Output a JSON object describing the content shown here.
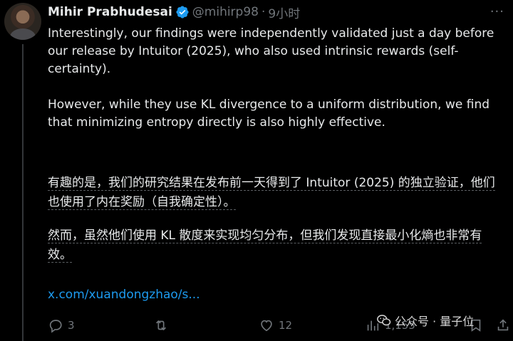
{
  "tweet": {
    "author_name": "Mihir Prabhudesai",
    "handle": "@mihirp98",
    "separator": "·",
    "time": "9小时",
    "verified_color": "#1d9bf0",
    "paragraphs": [
      "Interestingly, our findings were independently validated just a day before our release by Intuitor (2025), who also used intrinsic rewards (self-certainty).",
      "However, while they use KL divergence to a uniform distribution, we find that minimizing entropy directly is also highly effective."
    ],
    "translation": [
      "有趣的是，我们的研究结果在发布前一天得到了 Intuitor (2025) 的独立验证，他们也使用了内在奖励（自我确定性）。",
      "然而，虽然他们使用 KL 散度来实现均匀分布，但我们发现直接最小化熵也非常有效。"
    ],
    "link_text": "x.com/xuandongzhao/s...",
    "link_color": "#1d9bf0"
  },
  "actions": {
    "reply_count": "3",
    "retweet_count": "",
    "like_count": "12",
    "view_count": "1,155"
  },
  "icons": {
    "more": "more-icon",
    "reply": "reply-icon",
    "retweet": "retweet-icon",
    "like": "heart-icon",
    "views": "views-icon",
    "bookmark": "bookmark-icon",
    "share": "share-icon"
  },
  "watermark": {
    "text": "公众号 · 量子位"
  }
}
